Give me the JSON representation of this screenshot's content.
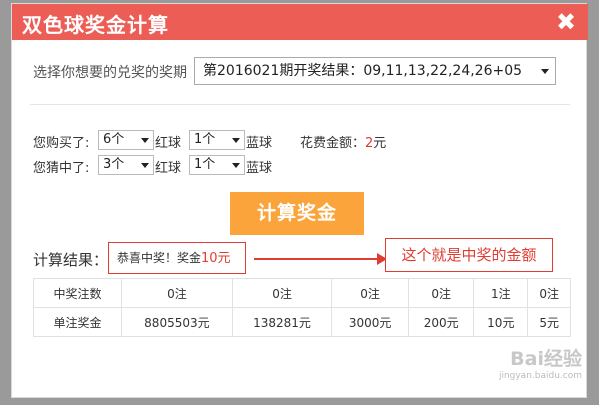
{
  "dialog": {
    "title": "双色球奖金计算",
    "close_glyph": "✖"
  },
  "period": {
    "label": "选择你想要的兑奖的奖期",
    "selected": "第2016021期开奖结果：09,11,13,22,24,26+05"
  },
  "bought": {
    "label": "您购买了:",
    "red_count": "6个",
    "red_label": "红球",
    "blue_count": "1个",
    "blue_label": "蓝球"
  },
  "cost": {
    "label": "花费金额：",
    "value": "2",
    "unit": "元"
  },
  "matched": {
    "label": "您猜中了:",
    "red_count": "3个",
    "red_label": "红球",
    "blue_count": "1个",
    "blue_label": "蓝球"
  },
  "calc_button": "计算奖金",
  "result": {
    "label": "计算结果：",
    "prefix": "恭喜中奖！奖金",
    "amount": "10元"
  },
  "annotation": "这个就是中奖的金额",
  "table": {
    "rows": [
      {
        "header": "中奖注数",
        "cells": [
          "0注",
          "0注",
          "0注",
          "0注",
          "1注",
          "0注"
        ]
      },
      {
        "header": "单注奖金",
        "cells": [
          "8805503元",
          "138281元",
          "3000元",
          "200元",
          "10元",
          "5元"
        ]
      }
    ]
  },
  "watermark": {
    "brand": "Bai经验",
    "url": "jingyan.baidu.com"
  },
  "colors": {
    "titlebar": "#ec5d56",
    "button": "#fba43b",
    "highlight": "#e03c31"
  }
}
